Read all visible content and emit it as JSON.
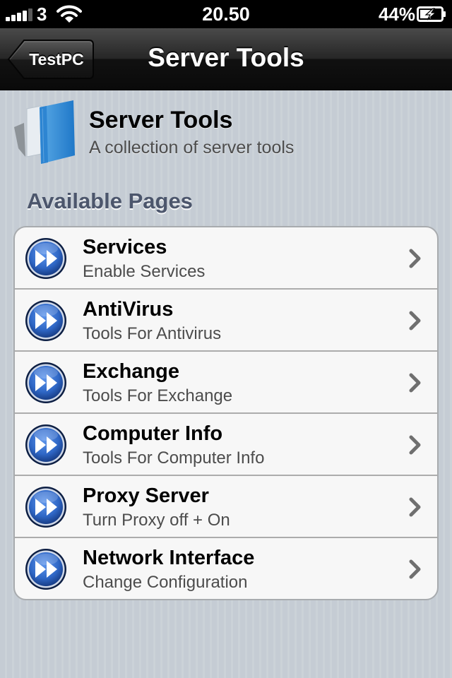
{
  "status_bar": {
    "carrier": "3",
    "time": "20.50",
    "battery_percent": "44%",
    "signal_icon": "signal-bars-icon",
    "wifi_icon": "wifi-icon",
    "battery_icon": "battery-charging-icon"
  },
  "nav": {
    "back_label": "TestPC",
    "title": "Server Tools"
  },
  "header": {
    "icon": "book-icon",
    "title": "Server Tools",
    "subtitle": "A collection of server tools"
  },
  "section": {
    "title": "Available Pages"
  },
  "items": [
    {
      "title": "Services",
      "subtitle": "Enable Services"
    },
    {
      "title": "AntiVirus",
      "subtitle": "Tools For Antivirus"
    },
    {
      "title": "Exchange",
      "subtitle": "Tools For Exchange"
    },
    {
      "title": "Computer Info",
      "subtitle": "Tools For Computer Info"
    },
    {
      "title": "Proxy Server",
      "subtitle": "Turn Proxy off + On"
    },
    {
      "title": "Network Interface",
      "subtitle": "Change Configuration"
    }
  ],
  "colors": {
    "background": "#c5ccd4",
    "section_header": "#4c566c",
    "item_icon": "#2f67c6"
  },
  "item_icon": "fast-forward-icon",
  "item_chevron": "chevron-right-icon"
}
